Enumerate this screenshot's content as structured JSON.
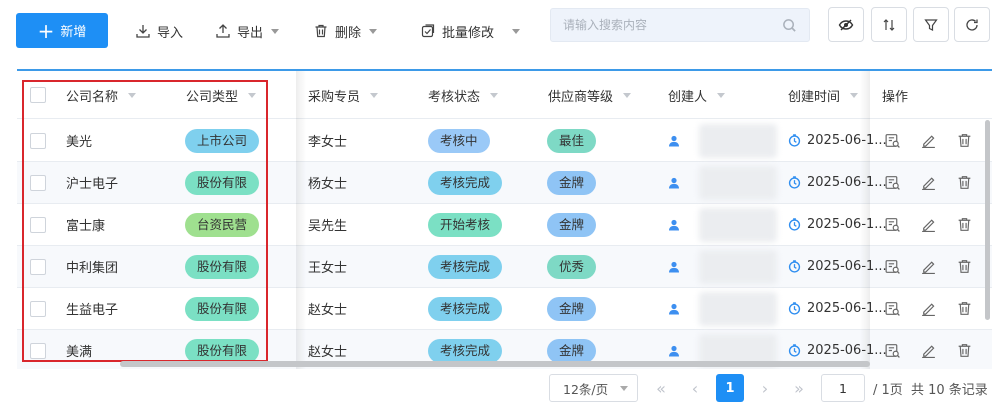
{
  "toolbar": {
    "add_label": "新增",
    "import_label": "导入",
    "export_label": "导出",
    "delete_label": "删除",
    "batch_edit_label": "批量修改",
    "search_placeholder": "请输入搜索内容"
  },
  "table": {
    "columns": {
      "company_name": "公司名称",
      "company_type": "公司类型",
      "buyer": "采购专员",
      "audit_status": "考核状态",
      "supplier_level": "供应商等级",
      "creator": "创建人",
      "created_time": "创建时间",
      "actions": "操作"
    },
    "rows": [
      {
        "name": "美光",
        "type": "上市公司",
        "type_color": "cyan",
        "buyer": "李女士",
        "status": "考核中",
        "status_color": "blue",
        "level": "最佳",
        "level_color": "teal",
        "time": "2025-06-1..."
      },
      {
        "name": "沪士电子",
        "type": "股份有限",
        "type_color": "green",
        "buyer": "杨女士",
        "status": "考核完成",
        "status_color": "cyan",
        "level": "金牌",
        "level_color": "gold",
        "time": "2025-06-1..."
      },
      {
        "name": "富士康",
        "type": "台资民营",
        "type_color": "lime",
        "buyer": "吴先生",
        "status": "开始考核",
        "status_color": "green",
        "level": "金牌",
        "level_color": "gold",
        "time": "2025-06-1..."
      },
      {
        "name": "中利集团",
        "type": "股份有限",
        "type_color": "green",
        "buyer": "王女士",
        "status": "考核完成",
        "status_color": "cyan",
        "level": "优秀",
        "level_color": "teal",
        "time": "2025-06-1..."
      },
      {
        "name": "生益电子",
        "type": "股份有限",
        "type_color": "green",
        "buyer": "赵女士",
        "status": "考核完成",
        "status_color": "cyan",
        "level": "金牌",
        "level_color": "gold",
        "time": "2025-06-1..."
      },
      {
        "name": "美满",
        "type": "股份有限",
        "type_color": "green",
        "buyer": "赵女士",
        "status": "考核完成",
        "status_color": "cyan",
        "level": "金牌",
        "level_color": "gold",
        "time": "2025-06-1..."
      }
    ]
  },
  "pagination": {
    "page_size": "12条/页",
    "current_page": "1",
    "jump_value": "1",
    "total_pages": "/ 1页",
    "total_records": "共 10 条记录"
  },
  "colors": {
    "primary": "#1e8ff5",
    "highlight_box": "#d9262c",
    "accent_line": "#3d9ae8"
  }
}
